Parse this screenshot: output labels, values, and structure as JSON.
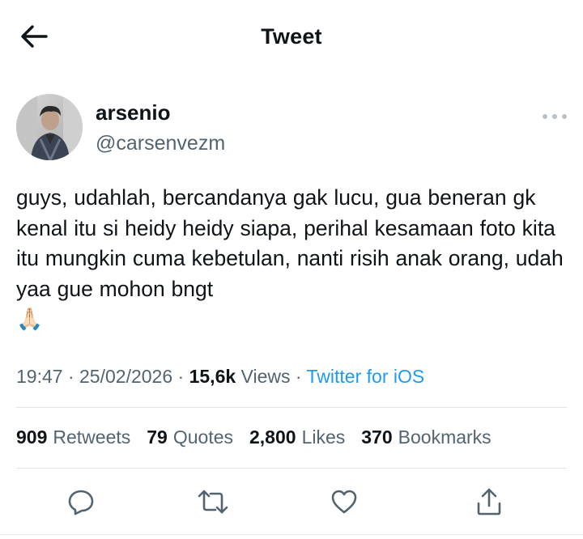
{
  "header": {
    "title": "Tweet",
    "back_icon": "arrow-left-icon"
  },
  "author": {
    "display_name": "arsenio",
    "handle": "@carsenvezm",
    "avatar_icon": "profile-photo"
  },
  "tweet": {
    "text": "guys, udahlah, bercandanya gak lucu, gua beneran gk kenal itu si heidy heidy siapa, perihal kesamaan foto kita itu mungkin cuma kebetulan, nanti risih anak orang, udah yaa gue mohon bngt\n🙏🏻"
  },
  "meta": {
    "time": "19:47",
    "separator": "·",
    "date": "25/02/2026",
    "views_count": "15,6k",
    "views_label": "Views",
    "source": "Twitter for iOS"
  },
  "stats": {
    "retweets_count": "909",
    "retweets_label": "Retweets",
    "quotes_count": "79",
    "quotes_label": "Quotes",
    "likes_count": "2,800",
    "likes_label": "Likes",
    "bookmarks_count": "370",
    "bookmarks_label": "Bookmarks"
  },
  "actions": {
    "reply_icon": "reply-icon",
    "retweet_icon": "retweet-icon",
    "like_icon": "heart-icon",
    "share_icon": "share-icon"
  },
  "colors": {
    "text": "#0f1419",
    "secondary": "#536471",
    "accent": "#1d9bf0",
    "divider": "#e1e5e8"
  }
}
